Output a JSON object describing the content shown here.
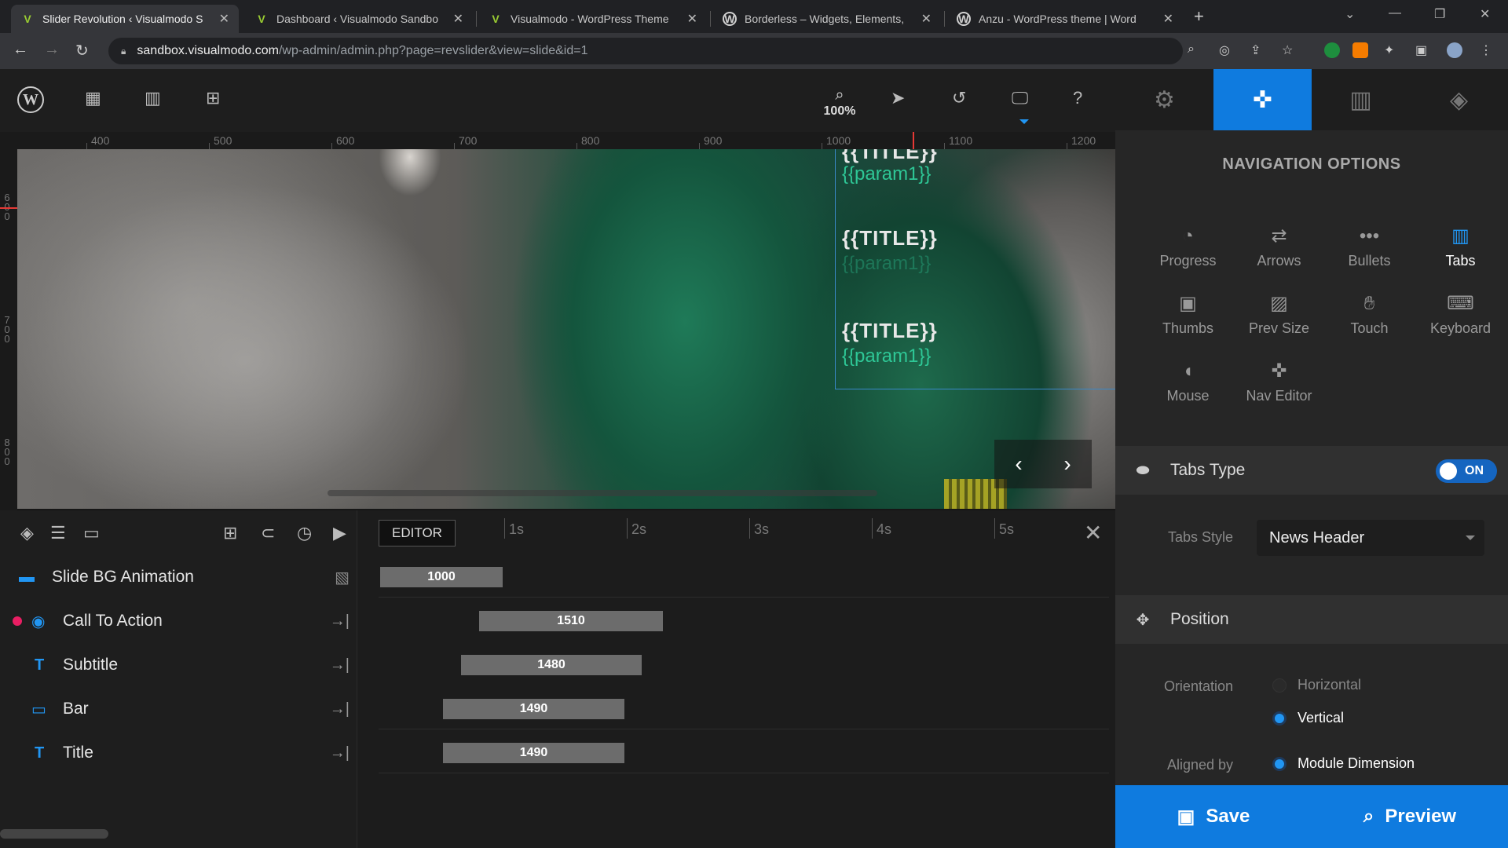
{
  "browser": {
    "tabs": [
      {
        "title": "Slider Revolution ‹ Visualmodo S",
        "icon": "visualmodo-icon",
        "active": true
      },
      {
        "title": "Dashboard ‹ Visualmodo Sandbo",
        "icon": "visualmodo-icon",
        "active": false
      },
      {
        "title": "Visualmodo - WordPress Theme",
        "icon": "visualmodo-icon",
        "active": false
      },
      {
        "title": "Borderless – Widgets, Elements,",
        "icon": "wordpress-icon",
        "active": false
      },
      {
        "title": "Anzu - WordPress theme | Word",
        "icon": "wordpress-icon",
        "active": false
      }
    ],
    "url_host": "sandbox.visualmodo.com",
    "url_path": "/wp-admin/admin.php?page=revslider&view=slide&id=1"
  },
  "toolbar": {
    "zoom": "100%"
  },
  "ruler": {
    "top_labels": [
      "400",
      "500",
      "600",
      "700",
      "800",
      "900",
      "1000",
      "1100",
      "1200"
    ],
    "left_labels": [
      "6 0 0",
      "7 0 0",
      "8 0 0"
    ]
  },
  "canvas": {
    "title_text_1": "{{TITLE}}",
    "param_text_1": "{{param1}}",
    "title_text_2": "{{TITLE}}",
    "param_text_2": "{{param1}}",
    "title_text_3": "{{TITLE}}",
    "param_text_3": "{{param1}}"
  },
  "timeline": {
    "editor_label": "EDITOR",
    "seconds": [
      "1s",
      "2s",
      "3s",
      "4s",
      "5s"
    ],
    "layers": [
      {
        "name": "Slide BG Animation",
        "icon": "image-icon",
        "bar": "1000"
      },
      {
        "name": "Call To Action",
        "icon": "target-icon",
        "bar": "1510"
      },
      {
        "name": "Subtitle",
        "icon": "text-icon",
        "bar": "1480"
      },
      {
        "name": "Bar",
        "icon": "shape-icon",
        "bar": "1490"
      },
      {
        "name": "Title",
        "icon": "text-icon",
        "bar": "1490"
      }
    ]
  },
  "sidebar": {
    "title": "NAVIGATION OPTIONS",
    "options": [
      {
        "label": "Progress",
        "icon": "progress-icon",
        "active": false
      },
      {
        "label": "Arrows",
        "icon": "arrows-icon",
        "active": false
      },
      {
        "label": "Bullets",
        "icon": "bullets-icon",
        "active": false
      },
      {
        "label": "Tabs",
        "icon": "tabs-icon",
        "active": true
      },
      {
        "label": "Thumbs",
        "icon": "thumbs-icon",
        "active": false
      },
      {
        "label": "Prev Size",
        "icon": "image-icon",
        "active": false
      },
      {
        "label": "Touch",
        "icon": "hand-icon",
        "active": false
      },
      {
        "label": "Keyboard",
        "icon": "keyboard-icon",
        "active": false
      },
      {
        "label": "Mouse",
        "icon": "mouse-icon",
        "active": false
      },
      {
        "label": "Nav Editor",
        "icon": "nav-editor-icon",
        "active": false
      }
    ],
    "tabs_type": {
      "label": "Tabs Type",
      "toggle": "ON"
    },
    "tabs_style": {
      "label": "Tabs Style",
      "value": "News Header"
    },
    "position": {
      "label": "Position",
      "orientation_label": "Orientation",
      "horizontal": "Horizontal",
      "vertical": "Vertical",
      "aligned_label": "Aligned by",
      "aligned_value": "Module Dimension"
    },
    "save_label": "Save",
    "preview_label": "Preview"
  },
  "colors": {
    "accent": "#0f7bdf",
    "param_text": "#2ec796",
    "record_dot": "#e91e63"
  }
}
